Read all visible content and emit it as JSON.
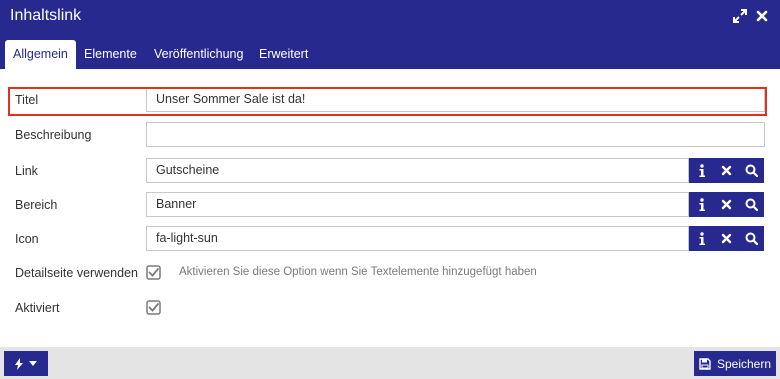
{
  "window": {
    "title": "Inhaltslink"
  },
  "tabs": [
    {
      "label": "Allgemein",
      "active": true
    },
    {
      "label": "Elemente",
      "active": false
    },
    {
      "label": "Veröffentlichung",
      "active": false
    },
    {
      "label": "Erweitert",
      "active": false
    }
  ],
  "form": {
    "titel": {
      "label": "Titel",
      "value": "Unser Sommer Sale ist da!"
    },
    "beschreibung": {
      "label": "Beschreibung",
      "value": ""
    },
    "link": {
      "label": "Link",
      "value": "Gutscheine"
    },
    "bereich": {
      "label": "Bereich",
      "value": "Banner"
    },
    "icon": {
      "label": "Icon",
      "value": "fa-light-sun"
    },
    "detailseite": {
      "label": "Detailseite verwenden",
      "checked": true,
      "hint": "Aktivieren Sie diese Option wenn Sie Textelemente hinzugefügt haben"
    },
    "aktiviert": {
      "label": "Aktiviert",
      "checked": true
    }
  },
  "footer": {
    "save_label": "Speichern"
  },
  "colors": {
    "primary": "#27298e",
    "highlight": "#e0301e",
    "footer_bg": "#e4e4e4"
  },
  "icons": [
    "expand-icon",
    "close-icon",
    "info-icon",
    "clear-icon",
    "search-icon",
    "bolt-icon",
    "caret-down-icon",
    "save-icon",
    "checkmark-icon"
  ]
}
